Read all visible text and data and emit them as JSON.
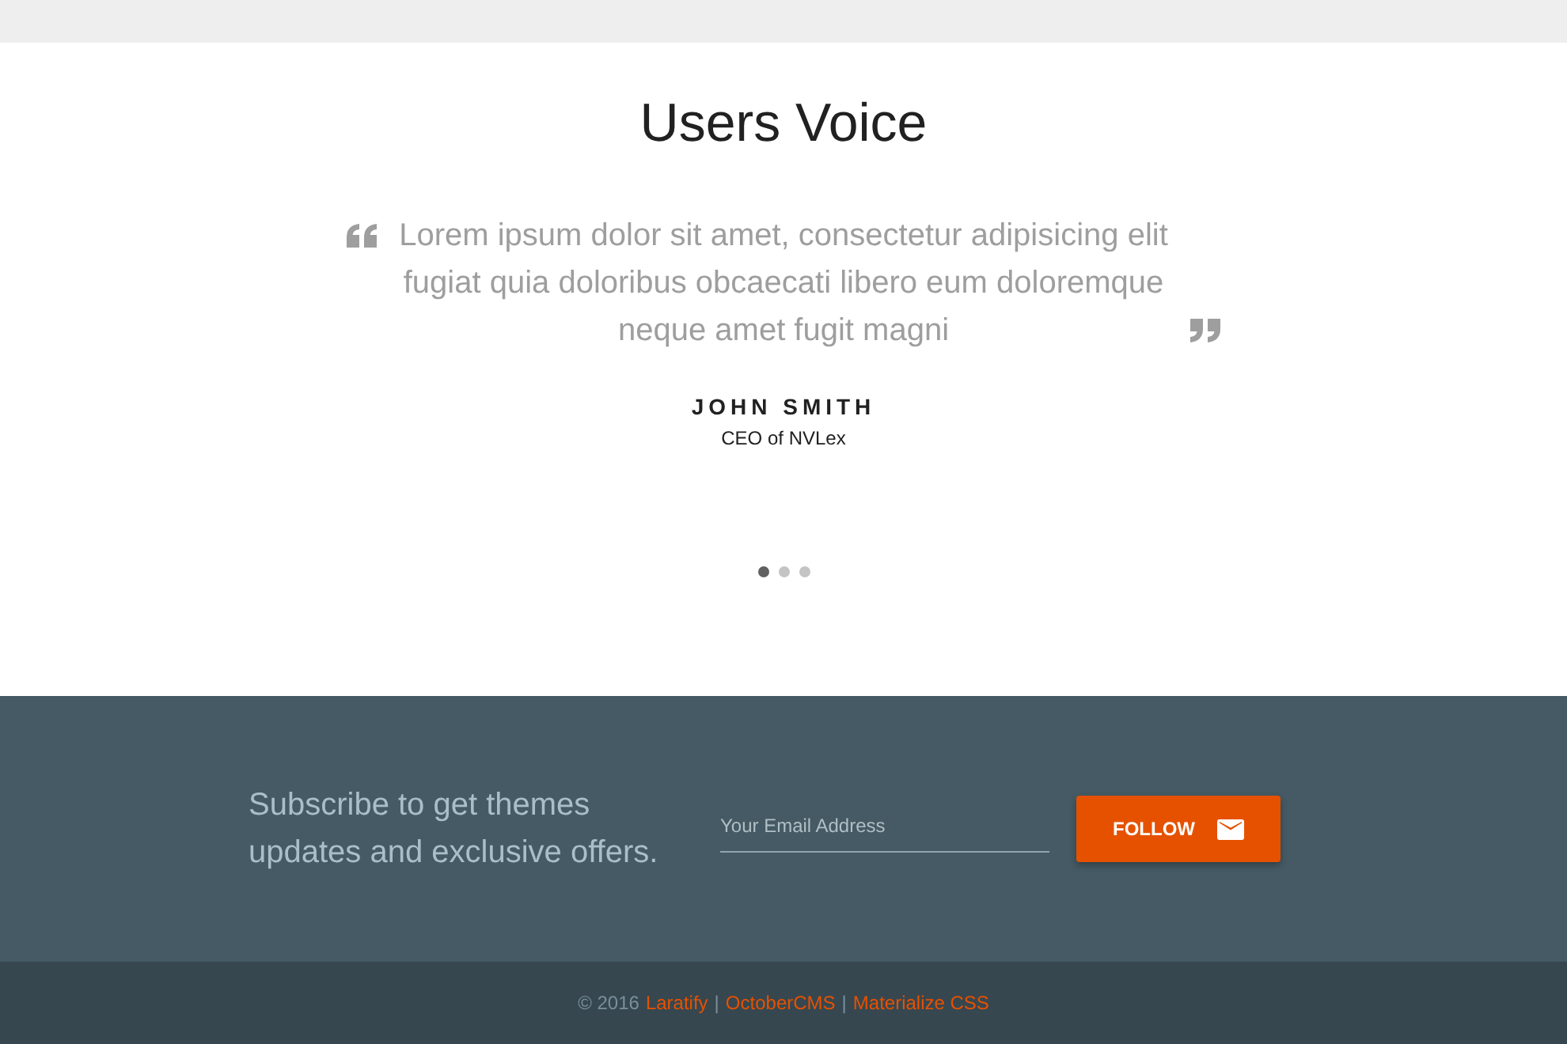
{
  "testimonials": {
    "title": "Users Voice",
    "quote": "Lorem ipsum dolor sit amet, consectetur adipisicing elit fugiat quia doloribus obcaecati libero eum doloremque neque amet fugit magni",
    "author": "JOHN SMITH",
    "role": "CEO of NVLex",
    "indicators": [
      {
        "selected": true
      },
      {
        "selected": false
      },
      {
        "selected": false
      }
    ]
  },
  "subscribe": {
    "text": "Subscribe to get themes updates and exclusive offers.",
    "email": {
      "placeholder": "Your Email Address"
    },
    "button": "FOLLOW"
  },
  "footer": {
    "items": [
      {
        "kind": "text",
        "text": "© 2016"
      },
      {
        "kind": "link",
        "text": "Laratify"
      },
      {
        "kind": "separator",
        "text": "|"
      },
      {
        "kind": "link",
        "text": "OctoberCMS"
      },
      {
        "kind": "separator",
        "text": "|"
      },
      {
        "kind": "link",
        "text": "Materialize CSS"
      }
    ]
  }
}
